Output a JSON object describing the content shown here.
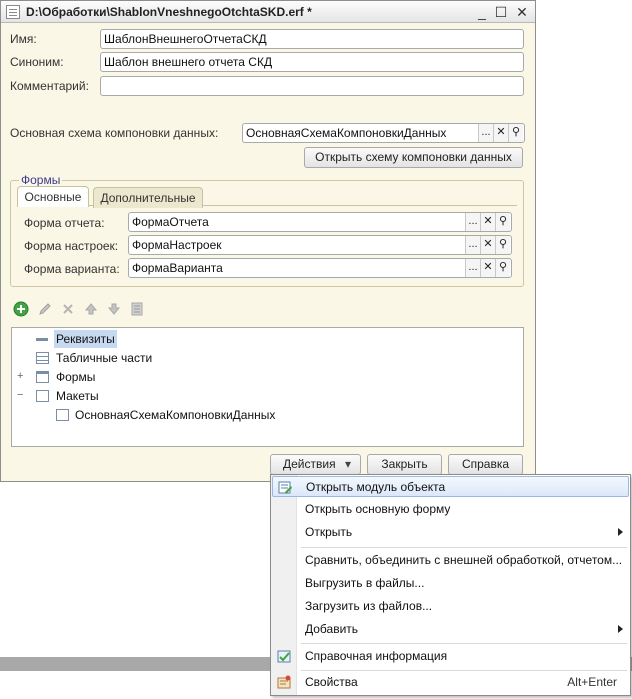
{
  "window": {
    "title": "D:\\Обработки\\ShablonVneshnegoOtchtaSKD.erf *",
    "minimize": "_",
    "maximize": "☐",
    "close": "✕"
  },
  "props": {
    "name_label": "Имя:",
    "name_value": "ШаблонВнешнегоОтчетаСКД",
    "synonym_label": "Синоним:",
    "synonym_value": "Шаблон внешнего отчета СКД",
    "comment_label": "Комментарий:",
    "comment_value": "",
    "schema_label": "Основная схема компоновки данных:",
    "schema_value": "ОсновнаяСхемаКомпоновкиДанных",
    "open_schema_button": "Открыть схему компоновки данных"
  },
  "forms": {
    "group_title": "Формы",
    "tabs": [
      "Основные",
      "Дополнительные"
    ],
    "rows": [
      {
        "label": "Форма отчета:",
        "value": "ФормаОтчета"
      },
      {
        "label": "Форма настроек:",
        "value": "ФормаНастроек"
      },
      {
        "label": "Форма варианта:",
        "value": "ФормаВарианта"
      }
    ]
  },
  "field_buttons": {
    "select": "...",
    "clear": "✕",
    "open": "⚲"
  },
  "tree": {
    "items": [
      {
        "label": "Реквизиты",
        "level": 0,
        "selected": true,
        "expander": ""
      },
      {
        "label": "Табличные части",
        "level": 0,
        "selected": false,
        "expander": ""
      },
      {
        "label": "Формы",
        "level": 0,
        "selected": false,
        "expander": "+"
      },
      {
        "label": "Макеты",
        "level": 0,
        "selected": false,
        "expander": "−"
      },
      {
        "label": "ОсновнаяСхемаКомпоновкиДанных",
        "level": 1,
        "selected": false,
        "expander": ""
      }
    ]
  },
  "footer": {
    "actions_button": "Действия",
    "actions_arrow": "▾",
    "close_button": "Закрыть",
    "help_button": "Справка"
  },
  "menu": {
    "items": [
      {
        "label": "Открыть модуль объекта",
        "highlighted": true,
        "submenu": false,
        "shortcut": ""
      },
      {
        "label": "Открыть основную форму",
        "highlighted": false,
        "submenu": false,
        "shortcut": ""
      },
      {
        "label": "Открыть",
        "highlighted": false,
        "submenu": true,
        "shortcut": ""
      },
      {
        "label": "Сравнить, объединить с внешней обработкой, отчетом...",
        "highlighted": false,
        "submenu": false,
        "shortcut": ""
      },
      {
        "label": "Выгрузить в файлы...",
        "highlighted": false,
        "submenu": false,
        "shortcut": ""
      },
      {
        "label": "Загрузить из файлов...",
        "highlighted": false,
        "submenu": false,
        "shortcut": ""
      },
      {
        "label": "Добавить",
        "highlighted": false,
        "submenu": true,
        "shortcut": ""
      },
      {
        "label": "Справочная информация",
        "highlighted": false,
        "submenu": false,
        "shortcut": ""
      },
      {
        "label": "Свойства",
        "highlighted": false,
        "submenu": false,
        "shortcut": "Alt+Enter"
      }
    ]
  },
  "colors": {
    "window_bg": "#faf7e6",
    "menu_highlight": "#dbe8f9",
    "tree_selected": "#c7d9f1",
    "add_icon_green": "#3fa540"
  }
}
